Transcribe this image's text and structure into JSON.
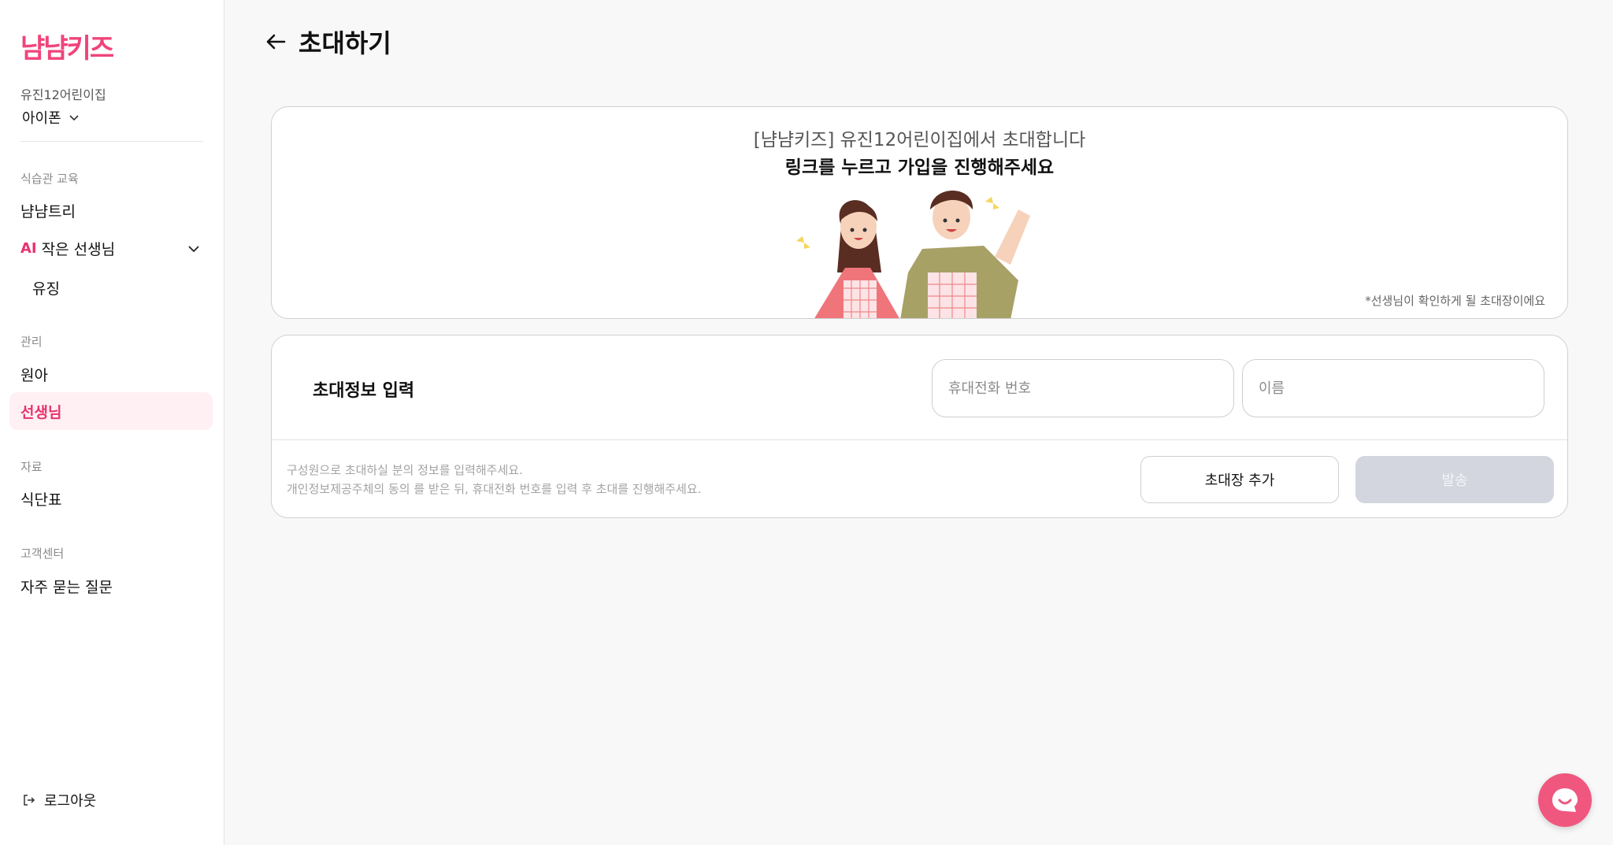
{
  "brand": {
    "logo_text": "냠냠키즈",
    "accent": "#e8336e"
  },
  "sidebar": {
    "org_name": "유진12어린이집",
    "device": "아이폰",
    "sections": [
      {
        "title": "식습관 교육",
        "items": [
          "냠냠트리"
        ]
      },
      {
        "title": "관리",
        "items": [
          "원아",
          "선생님"
        ]
      },
      {
        "title": "자료",
        "items": [
          "식단표"
        ]
      },
      {
        "title": "고객센터",
        "items": [
          "자주 묻는 질문"
        ]
      }
    ],
    "ai_group": {
      "badge": "AI",
      "label": "작은 선생님",
      "children": [
        "유징"
      ]
    },
    "active_item": "선생님",
    "logout": "로그아웃"
  },
  "page": {
    "title": "초대하기"
  },
  "preview": {
    "line1": "[냠냠키즈] 유진12어린이집에서 초대합니다",
    "line2": "링크를 누르고 가입을 진행해주세요",
    "note": "*선생님이 확인하게 될 초대장이에요"
  },
  "form": {
    "title": "초대정보 입력",
    "phone": {
      "placeholder": "휴대전화 번호",
      "value": ""
    },
    "name": {
      "placeholder": "이름",
      "value": ""
    },
    "help_line1": "구성원으로 초대하실 분의 정보를 입력해주세요.",
    "help_line2": "개인정보제공주체의 동의 를 받은 뒤, 휴대전화 번호를 입력 후 초대를 진행해주세요.",
    "add_button": "초대장 추가",
    "send_button": "발송"
  }
}
